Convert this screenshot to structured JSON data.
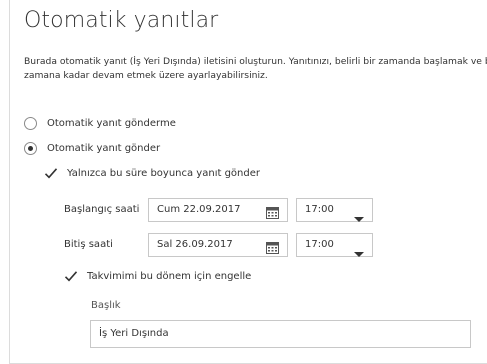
{
  "page": {
    "title": "Otomatik yanıtlar",
    "description": "Burada otomatik yanıt (İş Yeri Dışında) iletisini oluşturun. Yanıtınızı, belirli bir zamanda başlamak ve belirli bir zamana kadar devam etmek üzere ayarlayabilirsiniz."
  },
  "options": {
    "no_reply_label": "Otomatik yanıt gönderme",
    "send_reply_label": "Otomatik yanıt gönder",
    "selected": "send_reply"
  },
  "time_range": {
    "checkbox_label": "Yalnızca bu süre boyunca yanıt gönder",
    "checked": true,
    "start_label": "Başlangıç saati",
    "start_date": "Cum 22.09.2017",
    "start_time": "17:00",
    "end_label": "Bitiş saati",
    "end_date": "Sal 26.09.2017",
    "end_time": "17:00"
  },
  "calendar_block": {
    "checkbox_label": "Takvimimi bu dönem için engelle",
    "checked": true,
    "subject_label": "Başlık",
    "subject_value": "İş Yeri Dışında"
  },
  "colors": {
    "border": "#c8c8c8",
    "text": "#333333"
  }
}
